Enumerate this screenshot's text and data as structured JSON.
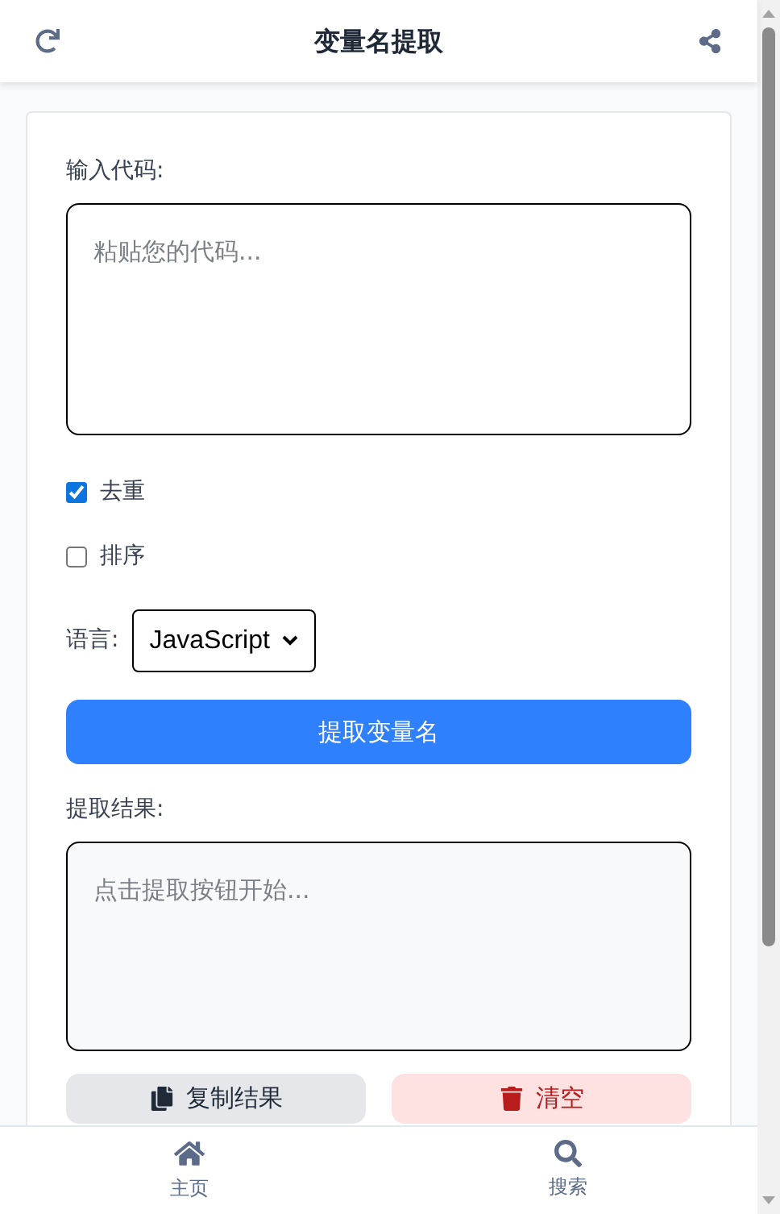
{
  "header": {
    "title": "变量名提取"
  },
  "input": {
    "label": "输入代码:",
    "placeholder": "粘贴您的代码..."
  },
  "options": [
    {
      "label": "去重",
      "checked": true
    },
    {
      "label": "排序",
      "checked": false
    }
  ],
  "language": {
    "label": "语言:",
    "value": "JavaScript"
  },
  "extract_button": "提取变量名",
  "result": {
    "label": "提取结果:",
    "placeholder": "点击提取按钮开始..."
  },
  "actions": [
    {
      "label": "复制结果",
      "kind": "copy"
    },
    {
      "label": "清空",
      "kind": "clear"
    }
  ],
  "nav": [
    {
      "label": "主页",
      "kind": "home"
    },
    {
      "label": "搜索",
      "kind": "search"
    }
  ]
}
